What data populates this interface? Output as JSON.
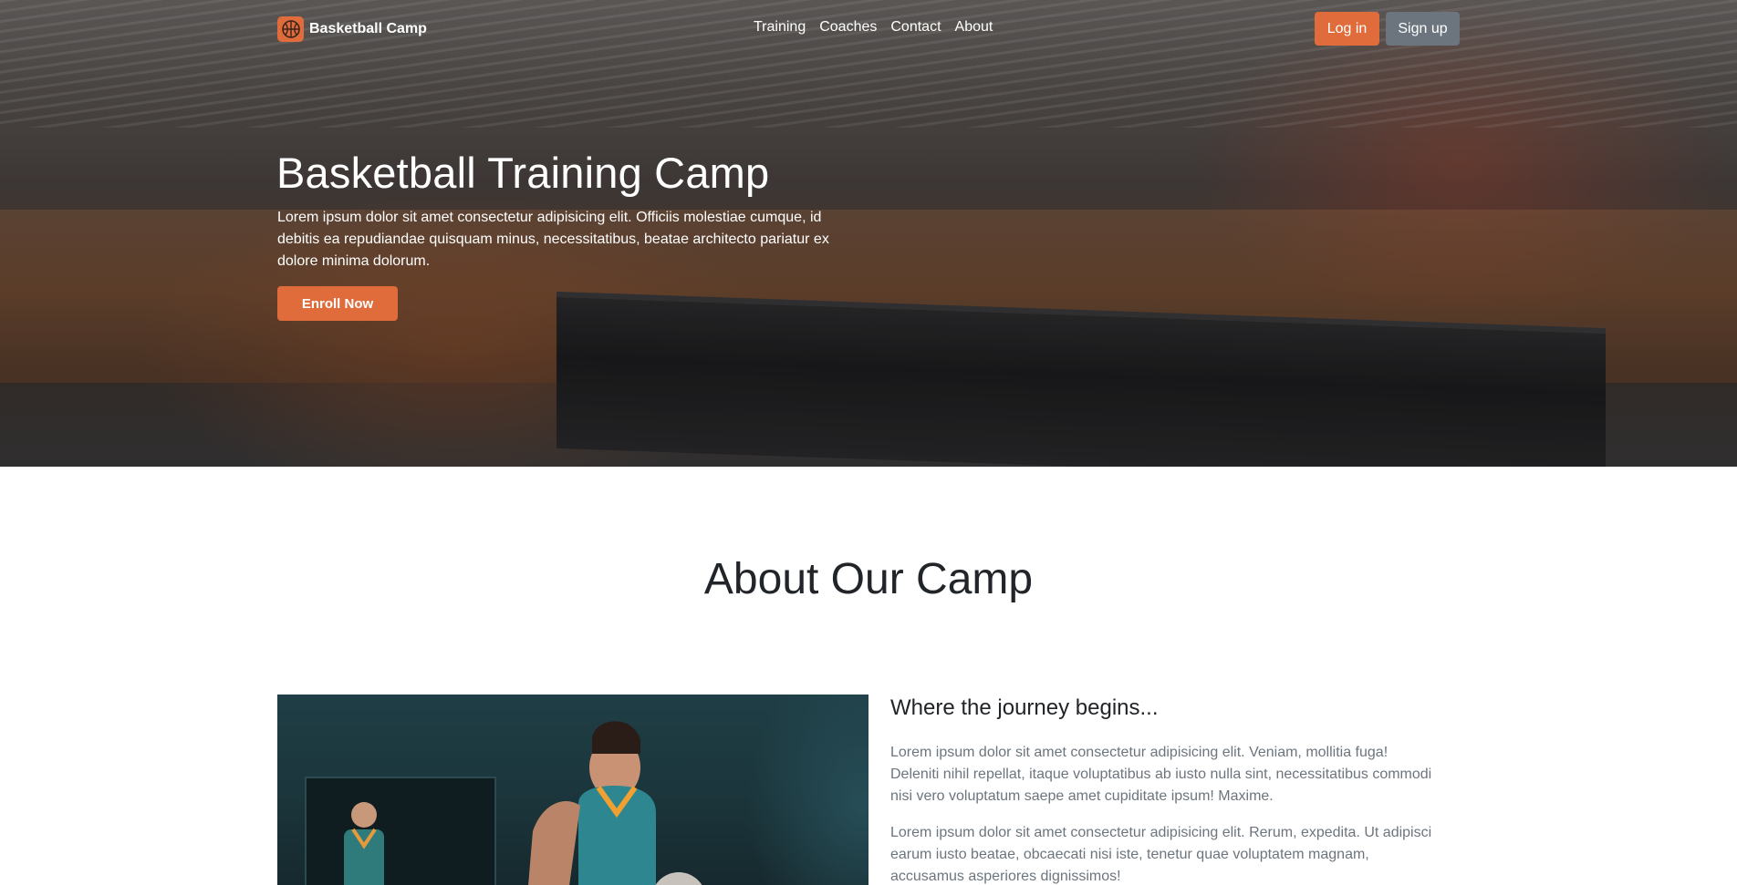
{
  "navbar": {
    "brand": "Basketball Camp",
    "brand_icon": "basketball-icon",
    "links": [
      "Training",
      "Coaches",
      "Contact",
      "About"
    ],
    "login_label": "Log in",
    "signup_label": "Sign up"
  },
  "hero": {
    "title": "Basketball Training Camp",
    "description": "Lorem ipsum dolor sit amet consectetur adipisicing elit. Officiis molestiae cumque, id debitis ea repudiandae quisquam minus, necessitatibus, beatae architecto pariatur ex dolore minima dolorum.",
    "cta_label": "Enroll Now"
  },
  "about": {
    "heading": "About Our Camp",
    "subheading": "Where the journey begins...",
    "paragraphs": [
      "Lorem ipsum dolor sit amet consectetur adipisicing elit. Veniam, mollitia fuga! Deleniti nihil repellat, itaque voluptatibus ab iusto nulla sint, necessitatibus commodi nisi vero voluptatum saepe amet cupiditate ipsum! Maxime.",
      "Lorem ipsum dolor sit amet consectetur adipisicing elit. Rerum, expedita. Ut adipisci earum iusto beatae, obcaecati nisi iste, tenetur quae voluptatem magnam, accusamus asperiores dignissimos!"
    ]
  },
  "colors": {
    "accent": "#e06c3c",
    "secondary": "#6c757d",
    "text_dark": "#212529",
    "text_muted": "#6c757d"
  }
}
